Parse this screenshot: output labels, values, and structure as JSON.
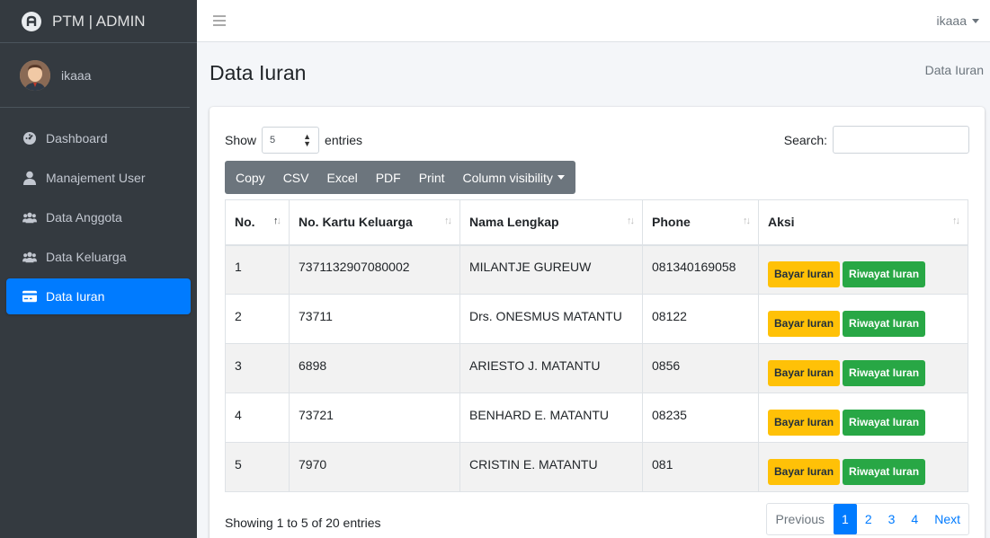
{
  "brand": {
    "title": "PTM | ADMIN"
  },
  "user": {
    "name": "ikaaa"
  },
  "sidebar": {
    "items": [
      {
        "label": "Dashboard",
        "icon": "dashboard-icon"
      },
      {
        "label": "Manajement User",
        "icon": "user-icon"
      },
      {
        "label": "Data Anggota",
        "icon": "users-icon"
      },
      {
        "label": "Data Keluarga",
        "icon": "users-icon"
      },
      {
        "label": "Data Iuran",
        "icon": "card-icon",
        "active": true
      }
    ]
  },
  "topbar": {
    "user": "ikaaa"
  },
  "page": {
    "title": "Data Iuran",
    "breadcrumb": "Data Iuran"
  },
  "table_controls": {
    "show_label": "Show",
    "entries_label": "entries",
    "page_length": "5",
    "search_label": "Search:",
    "search_value": ""
  },
  "export_buttons": {
    "copy": "Copy",
    "csv": "CSV",
    "excel": "Excel",
    "pdf": "PDF",
    "print": "Print",
    "colvis": "Column visibility"
  },
  "table": {
    "headers": [
      "No.",
      "No. Kartu Keluarga",
      "Nama Lengkap",
      "Phone",
      "Aksi"
    ],
    "rows": [
      [
        "1",
        "7371132907080002",
        "MILANTJE GUREUW",
        "081340169058"
      ],
      [
        "2",
        "73711",
        "Drs. ONESMUS MATANTU",
        "08122"
      ],
      [
        "3",
        "6898",
        "ARIESTO J. MATANTU",
        "0856"
      ],
      [
        "4",
        "73721",
        "BENHARD E. MATANTU",
        "08235"
      ],
      [
        "5",
        "7970",
        "CRISTIN E. MATANTU",
        "081"
      ]
    ],
    "action_pay": "Bayar Iuran",
    "action_history": "Riwayat Iuran"
  },
  "footer": {
    "info": "Showing 1 to 5 of 20 entries",
    "pagination": {
      "previous": "Previous",
      "pages": [
        "1",
        "2",
        "3",
        "4"
      ],
      "next": "Next",
      "current": "1"
    }
  },
  "colors": {
    "sidebar": "#343a40",
    "primary": "#007bff",
    "warning": "#ffc107",
    "success": "#28a745",
    "secondary": "#6c757d"
  }
}
